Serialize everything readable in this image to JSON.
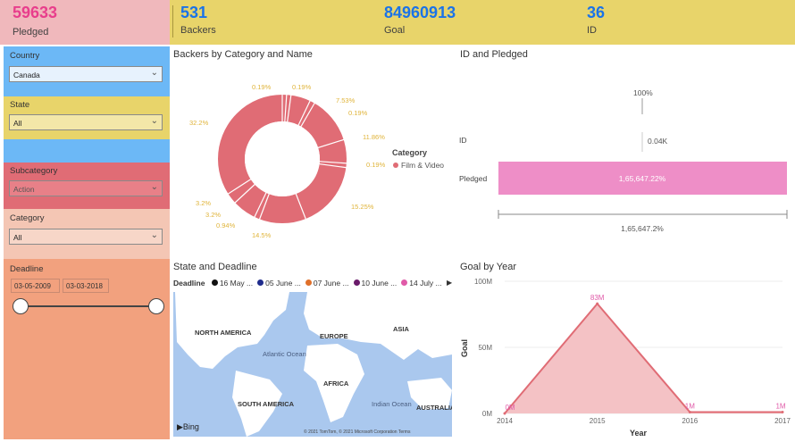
{
  "kpis": {
    "pledged": {
      "value": "59633",
      "label": "Pledged"
    },
    "backers": {
      "value": "531",
      "label": "Backers"
    },
    "goal": {
      "value": "84960913",
      "label": "Goal"
    },
    "id": {
      "value": "36",
      "label": "ID"
    }
  },
  "slicers": {
    "country": {
      "title": "Country",
      "value": "Canada"
    },
    "state": {
      "title": "State",
      "value": "All"
    },
    "subcategory": {
      "title": "Subcategory",
      "value": "Action"
    },
    "category": {
      "title": "Category",
      "value": "All"
    },
    "deadline": {
      "title": "Deadline",
      "start": "03-05-2009",
      "end": "03-03-2018"
    }
  },
  "donut": {
    "title": "Backers by Category and Name",
    "legend_title": "Category",
    "legend_item": "Film & Video",
    "labels": [
      "0.19%",
      "0.19%",
      "7.53%",
      "0.19%",
      "11.86%",
      "0.19%",
      "15.25%",
      "14.5%",
      "0.94%",
      "3.2%",
      "3.2%",
      "32.2%"
    ]
  },
  "id_pledged": {
    "title": "ID and Pledged",
    "top_label": "100%",
    "id_label": "ID",
    "id_value": "0.04K",
    "pledged_label": "Pledged",
    "bar_label": "1,65,647.22%",
    "axis_label": "1,65,647.2%"
  },
  "map": {
    "title": "State and Deadline",
    "legend_title": "Deadline",
    "legend_items": [
      "16 May ...",
      "05 June ...",
      "07 June ...",
      "10 June ...",
      "14 July ..."
    ],
    "legend_colors": [
      "#111111",
      "#1f2c8c",
      "#e0702a",
      "#6a1a6a",
      "#e05aa8"
    ],
    "continents": [
      "NORTH AMERICA",
      "EUROPE",
      "ASIA",
      "Atlantic Ocean",
      "AFRICA",
      "SOUTH AMERICA",
      "Indian Ocean",
      "AUSTRALIA"
    ],
    "bing": "Bing",
    "copyright": "© 2021 TomTom, © 2021 Microsoft Corporation Terms"
  },
  "chart_data": {
    "type": "area",
    "title": "Goal by Year",
    "xlabel": "Year",
    "ylabel": "Goal",
    "x": [
      2014,
      2015,
      2016,
      2017
    ],
    "values": [
      0,
      83,
      1,
      1
    ],
    "data_labels": [
      "0M",
      "83M",
      "1M",
      "1M"
    ],
    "y_ticks": [
      "0M",
      "50M",
      "100M"
    ],
    "ylim": [
      0,
      100
    ],
    "color": "#e06c75",
    "fill": "#f4c2c5"
  }
}
